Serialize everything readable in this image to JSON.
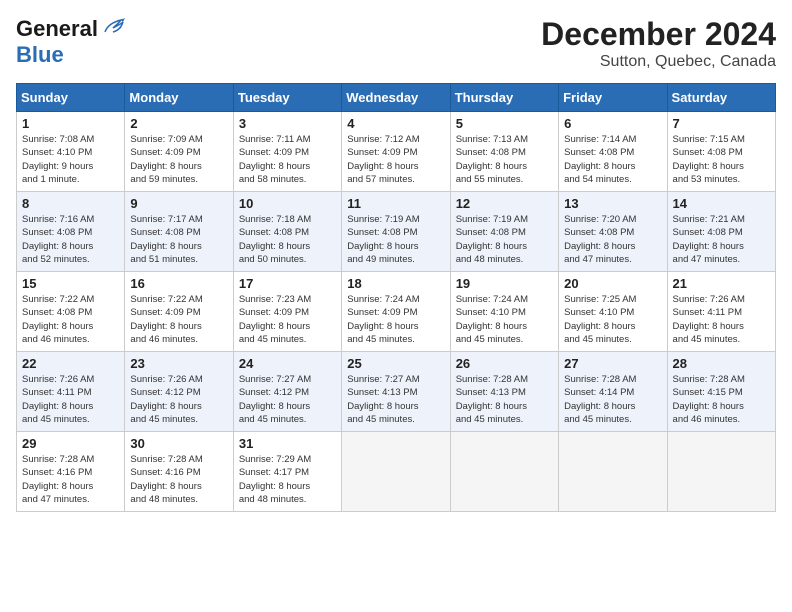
{
  "header": {
    "logo_line1": "General",
    "logo_line2": "Blue",
    "month": "December 2024",
    "location": "Sutton, Quebec, Canada"
  },
  "days_of_week": [
    "Sunday",
    "Monday",
    "Tuesday",
    "Wednesday",
    "Thursday",
    "Friday",
    "Saturday"
  ],
  "weeks": [
    [
      {
        "day": "1",
        "info": "Sunrise: 7:08 AM\nSunset: 4:10 PM\nDaylight: 9 hours\nand 1 minute."
      },
      {
        "day": "2",
        "info": "Sunrise: 7:09 AM\nSunset: 4:09 PM\nDaylight: 8 hours\nand 59 minutes."
      },
      {
        "day": "3",
        "info": "Sunrise: 7:11 AM\nSunset: 4:09 PM\nDaylight: 8 hours\nand 58 minutes."
      },
      {
        "day": "4",
        "info": "Sunrise: 7:12 AM\nSunset: 4:09 PM\nDaylight: 8 hours\nand 57 minutes."
      },
      {
        "day": "5",
        "info": "Sunrise: 7:13 AM\nSunset: 4:08 PM\nDaylight: 8 hours\nand 55 minutes."
      },
      {
        "day": "6",
        "info": "Sunrise: 7:14 AM\nSunset: 4:08 PM\nDaylight: 8 hours\nand 54 minutes."
      },
      {
        "day": "7",
        "info": "Sunrise: 7:15 AM\nSunset: 4:08 PM\nDaylight: 8 hours\nand 53 minutes."
      }
    ],
    [
      {
        "day": "8",
        "info": "Sunrise: 7:16 AM\nSunset: 4:08 PM\nDaylight: 8 hours\nand 52 minutes."
      },
      {
        "day": "9",
        "info": "Sunrise: 7:17 AM\nSunset: 4:08 PM\nDaylight: 8 hours\nand 51 minutes."
      },
      {
        "day": "10",
        "info": "Sunrise: 7:18 AM\nSunset: 4:08 PM\nDaylight: 8 hours\nand 50 minutes."
      },
      {
        "day": "11",
        "info": "Sunrise: 7:19 AM\nSunset: 4:08 PM\nDaylight: 8 hours\nand 49 minutes."
      },
      {
        "day": "12",
        "info": "Sunrise: 7:19 AM\nSunset: 4:08 PM\nDaylight: 8 hours\nand 48 minutes."
      },
      {
        "day": "13",
        "info": "Sunrise: 7:20 AM\nSunset: 4:08 PM\nDaylight: 8 hours\nand 47 minutes."
      },
      {
        "day": "14",
        "info": "Sunrise: 7:21 AM\nSunset: 4:08 PM\nDaylight: 8 hours\nand 47 minutes."
      }
    ],
    [
      {
        "day": "15",
        "info": "Sunrise: 7:22 AM\nSunset: 4:08 PM\nDaylight: 8 hours\nand 46 minutes."
      },
      {
        "day": "16",
        "info": "Sunrise: 7:22 AM\nSunset: 4:09 PM\nDaylight: 8 hours\nand 46 minutes."
      },
      {
        "day": "17",
        "info": "Sunrise: 7:23 AM\nSunset: 4:09 PM\nDaylight: 8 hours\nand 45 minutes."
      },
      {
        "day": "18",
        "info": "Sunrise: 7:24 AM\nSunset: 4:09 PM\nDaylight: 8 hours\nand 45 minutes."
      },
      {
        "day": "19",
        "info": "Sunrise: 7:24 AM\nSunset: 4:10 PM\nDaylight: 8 hours\nand 45 minutes."
      },
      {
        "day": "20",
        "info": "Sunrise: 7:25 AM\nSunset: 4:10 PM\nDaylight: 8 hours\nand 45 minutes."
      },
      {
        "day": "21",
        "info": "Sunrise: 7:26 AM\nSunset: 4:11 PM\nDaylight: 8 hours\nand 45 minutes."
      }
    ],
    [
      {
        "day": "22",
        "info": "Sunrise: 7:26 AM\nSunset: 4:11 PM\nDaylight: 8 hours\nand 45 minutes."
      },
      {
        "day": "23",
        "info": "Sunrise: 7:26 AM\nSunset: 4:12 PM\nDaylight: 8 hours\nand 45 minutes."
      },
      {
        "day": "24",
        "info": "Sunrise: 7:27 AM\nSunset: 4:12 PM\nDaylight: 8 hours\nand 45 minutes."
      },
      {
        "day": "25",
        "info": "Sunrise: 7:27 AM\nSunset: 4:13 PM\nDaylight: 8 hours\nand 45 minutes."
      },
      {
        "day": "26",
        "info": "Sunrise: 7:28 AM\nSunset: 4:13 PM\nDaylight: 8 hours\nand 45 minutes."
      },
      {
        "day": "27",
        "info": "Sunrise: 7:28 AM\nSunset: 4:14 PM\nDaylight: 8 hours\nand 45 minutes."
      },
      {
        "day": "28",
        "info": "Sunrise: 7:28 AM\nSunset: 4:15 PM\nDaylight: 8 hours\nand 46 minutes."
      }
    ],
    [
      {
        "day": "29",
        "info": "Sunrise: 7:28 AM\nSunset: 4:16 PM\nDaylight: 8 hours\nand 47 minutes."
      },
      {
        "day": "30",
        "info": "Sunrise: 7:28 AM\nSunset: 4:16 PM\nDaylight: 8 hours\nand 48 minutes."
      },
      {
        "day": "31",
        "info": "Sunrise: 7:29 AM\nSunset: 4:17 PM\nDaylight: 8 hours\nand 48 minutes."
      },
      {
        "empty": true
      },
      {
        "empty": true
      },
      {
        "empty": true
      },
      {
        "empty": true
      }
    ]
  ]
}
